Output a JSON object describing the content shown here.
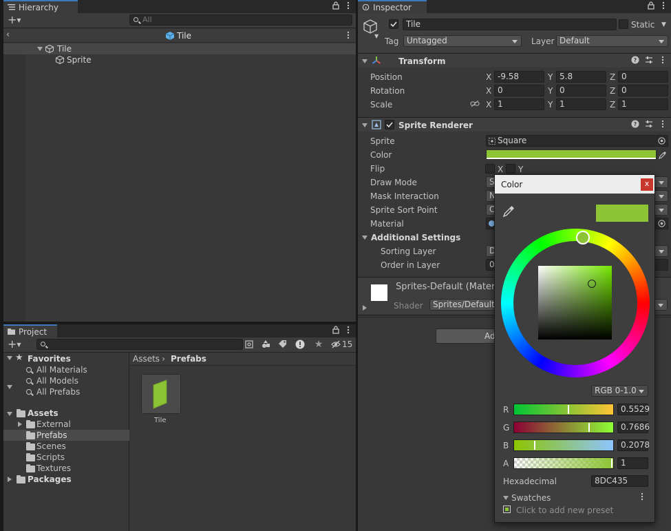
{
  "hierarchy": {
    "tab_label": "Hierarchy",
    "search_placeholder": "All",
    "breadcrumb": "Tile",
    "items": [
      {
        "label": "Tile"
      },
      {
        "label": "Sprite"
      }
    ]
  },
  "project": {
    "tab_label": "Project",
    "hidden_count": "15",
    "favorites": {
      "label": "Favorites",
      "items": [
        "All Materials",
        "All Models",
        "All Prefabs"
      ]
    },
    "assets": {
      "label": "Assets",
      "items": [
        "External",
        "Prefabs",
        "Scenes",
        "Scripts",
        "Textures"
      ]
    },
    "packages_label": "Packages",
    "breadcrumb": {
      "root": "Assets",
      "current": "Prefabs"
    },
    "grid_items": [
      {
        "label": "Tile"
      }
    ]
  },
  "inspector": {
    "tab_label": "Inspector",
    "object_name": "Tile",
    "static_label": "Static",
    "tag_label": "Tag",
    "tag_value": "Untagged",
    "layer_label": "Layer",
    "layer_value": "Default",
    "transform": {
      "title": "Transform",
      "position_label": "Position",
      "rotation_label": "Rotation",
      "scale_label": "Scale",
      "axis_x": "X",
      "axis_y": "Y",
      "axis_z": "Z",
      "position": {
        "x": "-9.58",
        "y": "5.8",
        "z": "0"
      },
      "rotation": {
        "x": "0",
        "y": "0",
        "z": "0"
      },
      "scale": {
        "x": "1",
        "y": "1",
        "z": "1"
      }
    },
    "sprite_renderer": {
      "title": "Sprite Renderer",
      "sprite_label": "Sprite",
      "sprite_value": "Square",
      "color_label": "Color",
      "flip_label": "Flip",
      "flip_x": "X",
      "flip_y": "Y",
      "draw_mode_label": "Draw Mode",
      "draw_mode_value": "S",
      "mask_interaction_label": "Mask Interaction",
      "mask_interaction_value": "N",
      "sort_point_label": "Sprite Sort Point",
      "sort_point_value": "C",
      "material_label": "Material",
      "additional_settings_label": "Additional Settings",
      "sorting_layer_label": "Sorting Layer",
      "sorting_layer_value": "D",
      "order_in_layer_label": "Order in Layer",
      "order_in_layer_value": "0"
    },
    "material_section": {
      "name": "Sprites-Default (Materi",
      "shader_label": "Shader",
      "shader_value": "Sprites/Default"
    },
    "add_component_label": "Ad"
  },
  "color_picker": {
    "title": "Color",
    "close_label": "x",
    "mode": "RGB 0-1.0",
    "channels": [
      {
        "label": "R",
        "value": "0.5529",
        "fraction": 0.5529
      },
      {
        "label": "G",
        "value": "0.7686",
        "fraction": 0.7686
      },
      {
        "label": "B",
        "value": "0.2078",
        "fraction": 0.2078
      },
      {
        "label": "A",
        "value": "1",
        "fraction": 1
      }
    ],
    "hex_label": "Hexadecimal",
    "hex_value": "8DC435",
    "swatches_label": "Swatches",
    "add_preset_label": "Click to add new preset"
  },
  "colors": {
    "selected_color": "#8DC435",
    "accent": "#3a79bb"
  }
}
